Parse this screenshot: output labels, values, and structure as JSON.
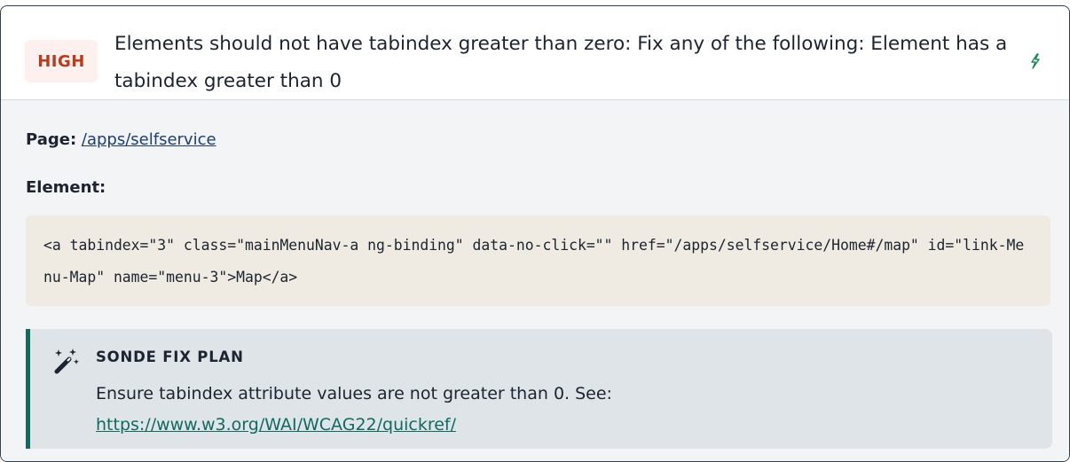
{
  "issue": {
    "severity": "HIGH",
    "title": "Elements should not have tabindex greater than zero: Fix any of the following: Element has a tabindex greater than 0",
    "action_icon": "bolt-icon",
    "colors": {
      "severity_text": "#b93a1d",
      "severity_bg": "#fdf0ee",
      "border": "#324152"
    }
  },
  "details": {
    "page_label": "Page:",
    "page_link": "/apps/selfservice",
    "element_label": "Element:",
    "element_code": "<a tabindex=\"3\" class=\"mainMenuNav-a ng-binding\" data-no-click=\"\" href=\"/apps/selfservice/Home#/map\" id=\"link-Menu-Map\" name=\"menu-3\">Map</a>"
  },
  "fix_plan": {
    "icon": "magic-wand-icon",
    "label": "SONDE FIX PLAN",
    "text": "Ensure tabindex attribute values are not greater than 0. See:",
    "link": "https://www.w3.org/WAI/WCAG22/quickref/",
    "accent_color": "#0f6b60"
  }
}
